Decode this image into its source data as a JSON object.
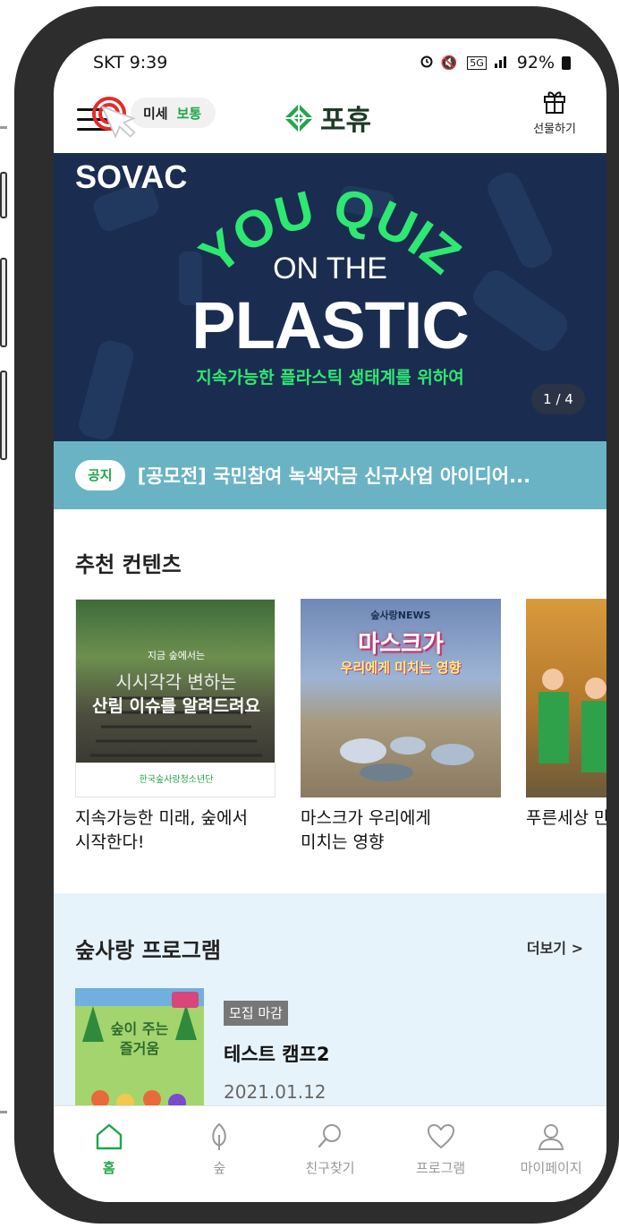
{
  "status_bar": {
    "carrier_time": "SKT 9:39",
    "network": "5G",
    "battery": "92%"
  },
  "header": {
    "dust_label": "미세",
    "dust_status": "보통",
    "logo_text": "포휴",
    "gift_label": "선물하기"
  },
  "banner": {
    "brand": "SOVAC",
    "headline_top": "YOU QUIZ",
    "headline_mid": "ON THE",
    "headline_main": "PLASTIC",
    "subtitle": "지속가능한 플라스틱 생태계를 위하여",
    "counter": "1 / 4"
  },
  "notice": {
    "badge": "공지",
    "text": "[공모전] 국민참여 녹색자금 신규사업 아이디어..."
  },
  "recommended": {
    "title": "추천 컨텐츠",
    "cards": [
      {
        "caption": "지속가능한 미래, 숲에서\n시작한다!",
        "img_small": "지금 숲에서는",
        "img_line1": "시시각각 변하는",
        "img_line2": "산림 이슈를 알려드려요",
        "img_org": "한국숲사랑청소년단"
      },
      {
        "caption": "마스크가 우리에게\n미치는 영향",
        "img_small": "숲사랑NEWS",
        "img_line1": "마스크가",
        "img_line2": "우리에게 미치는 영향"
      },
      {
        "caption": "푸른세상 만"
      }
    ]
  },
  "program": {
    "title": "숲사랑 프로그램",
    "more": "더보기 >",
    "item": {
      "badge": "모집 마감",
      "title": "테스트 캠프2",
      "date": "2021.01.12",
      "thumb_line1": "숲이 주는",
      "thumb_line2": "즐거움"
    }
  },
  "nav": {
    "items": [
      {
        "label": "홈",
        "icon": "home-icon"
      },
      {
        "label": "숲",
        "icon": "leaf-icon"
      },
      {
        "label": "친구찾기",
        "icon": "search-icon"
      },
      {
        "label": "프로그램",
        "icon": "heart-icon"
      },
      {
        "label": "마이페이지",
        "icon": "person-icon"
      }
    ]
  },
  "colors": {
    "brand_green": "#1fa64a",
    "banner_bg": "#1a2d50",
    "notice_bg": "#6ab3c4",
    "program_bg": "#e7f3fb",
    "phone_frame": "#2d2d2d"
  }
}
